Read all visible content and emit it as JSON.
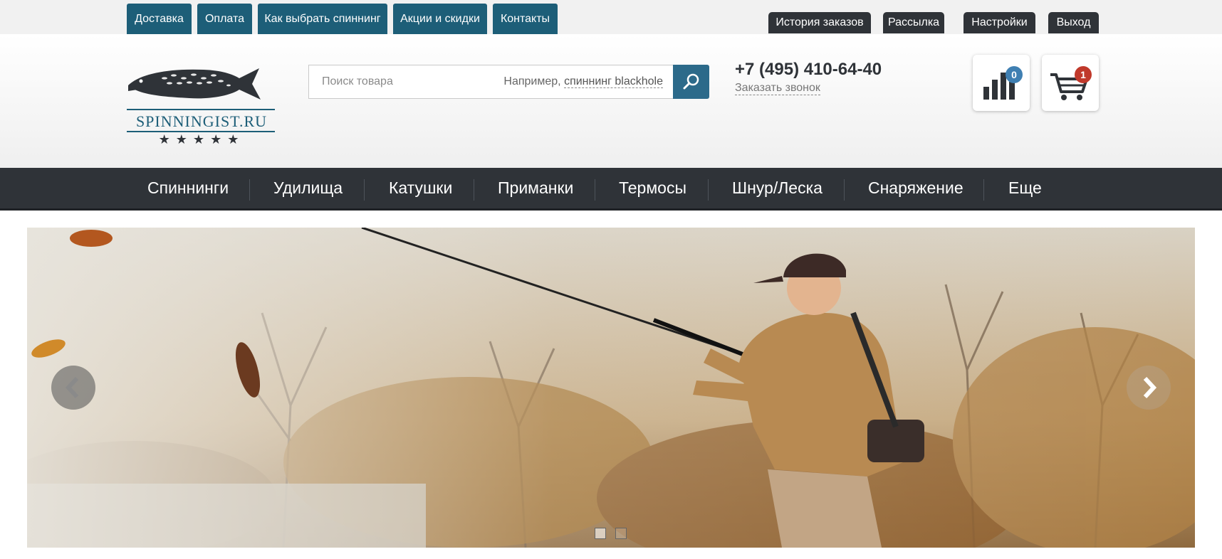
{
  "top_links": [
    "Доставка",
    "Оплата",
    "Как выбрать спиннинг",
    "Акции и скидки",
    "Контакты"
  ],
  "user_links": [
    "История заказов",
    "Рассылка",
    "Настройки",
    "Выход"
  ],
  "logo": {
    "text": "SPINNINGIST.RU"
  },
  "search": {
    "placeholder": "Поиск товара",
    "hint_prefix": "Например,",
    "hint_example": "спиннинг blackhole"
  },
  "contact": {
    "phone": "+7 (495) 410-64-40",
    "callback": "Заказать звонок"
  },
  "compare": {
    "count": "0",
    "icon": "bar-chart-icon"
  },
  "cart": {
    "count": "1",
    "icon": "cart-icon"
  },
  "nav": [
    "Спиннинги",
    "Удилища",
    "Катушки",
    "Приманки",
    "Термосы",
    "Шнур/Леска",
    "Снаряжение",
    "Еще"
  ],
  "slider": {
    "slides": 2,
    "active": 1
  },
  "colors": {
    "accent": "#1d5e78",
    "dark": "#2f3338",
    "compare_badge": "#3f7fb2",
    "cart_badge": "#c0392b"
  }
}
